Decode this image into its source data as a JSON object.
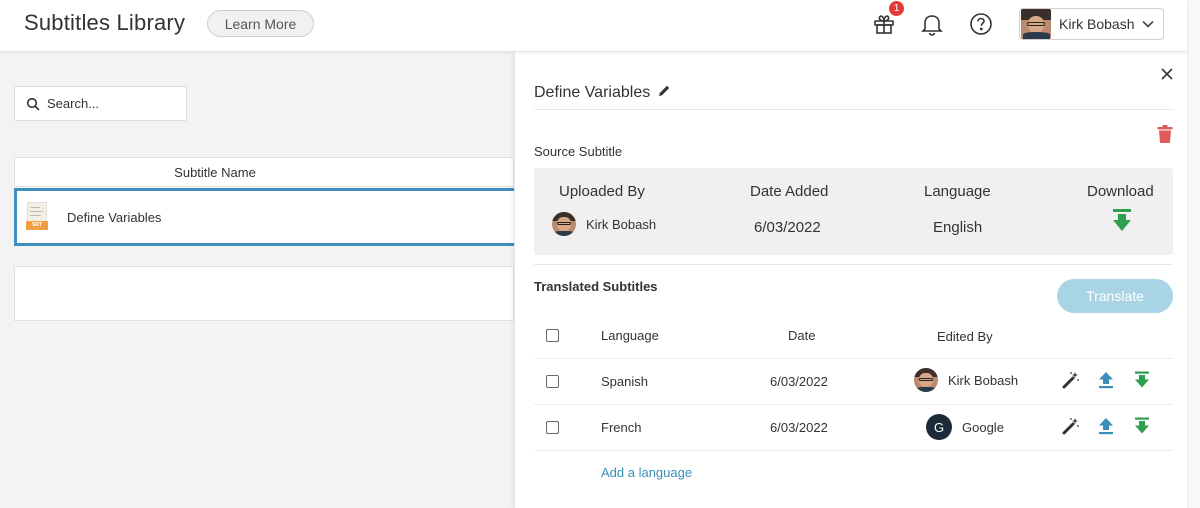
{
  "header": {
    "title": "Subtitles Library",
    "learn_more": "Learn More",
    "gift_badge": "1",
    "user_name": "Kirk Bobash"
  },
  "search": {
    "placeholder": "Search..."
  },
  "list": {
    "column_header": "Subtitle Name",
    "rows": [
      {
        "name": "Define Variables",
        "file_type": "SRT"
      }
    ]
  },
  "panel": {
    "title": "Define Variables",
    "source_label": "Source Subtitle",
    "source": {
      "headers": [
        "Uploaded By",
        "Date Added",
        "Language",
        "Download"
      ],
      "uploaded_by": "Kirk Bobash",
      "date_added": "6/03/2022",
      "language": "English"
    },
    "translated_label": "Translated Subtitles",
    "translate_button": "Translate",
    "table": {
      "headers": [
        "Language",
        "Date",
        "Edited By"
      ],
      "rows": [
        {
          "language": "Spanish",
          "date": "6/03/2022",
          "edited_by": "Kirk Bobash",
          "editor_avatar": "photo"
        },
        {
          "language": "French",
          "date": "6/03/2022",
          "edited_by": "Google",
          "editor_avatar": "G"
        }
      ]
    },
    "add_language": "Add a language"
  },
  "colors": {
    "accent_blue": "#3f8fbf",
    "download_green": "#2e9e4f",
    "delete_red": "#e05a5a",
    "translate_button_disabled": "#a8d4e5",
    "link_blue": "#3a8fb7"
  }
}
